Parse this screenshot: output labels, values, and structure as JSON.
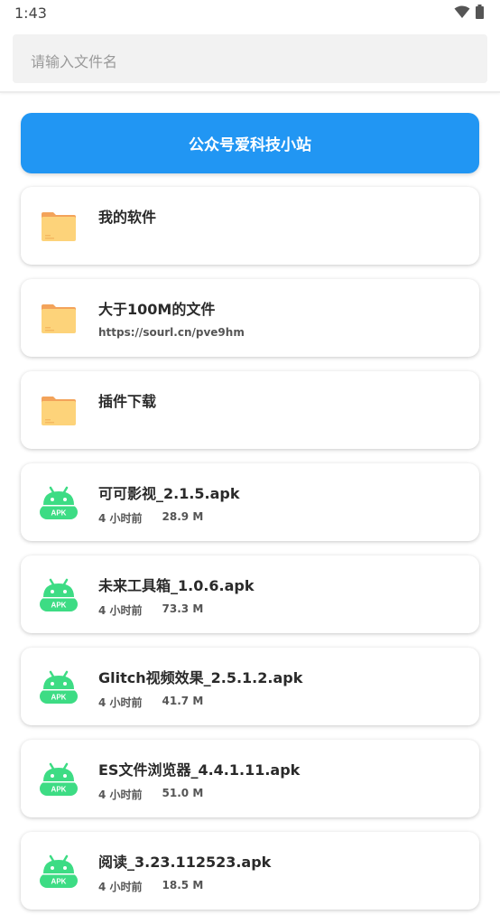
{
  "status_bar": {
    "time": "1:43"
  },
  "search": {
    "placeholder": "请输入文件名"
  },
  "banner": {
    "label": "公众号爱科技小站"
  },
  "folders": [
    {
      "name": "我的软件",
      "subtitle": ""
    },
    {
      "name": "大于100M的文件",
      "subtitle": "https://sourl.cn/pve9hm"
    },
    {
      "name": "插件下载",
      "subtitle": ""
    }
  ],
  "files": [
    {
      "name": "可可影视_2.1.5.apk",
      "time": "4 小时前",
      "size": "28.9 M"
    },
    {
      "name": "未来工具箱_1.0.6.apk",
      "time": "4 小时前",
      "size": "73.3 M"
    },
    {
      "name": "Glitch视频效果_2.5.1.2.apk",
      "time": "4 小时前",
      "size": "41.7 M"
    },
    {
      "name": "ES文件浏览器_4.4.1.11.apk",
      "time": "4 小时前",
      "size": "51.0 M"
    },
    {
      "name": "阅读_3.23.112523.apk",
      "time": "4 小时前",
      "size": "18.5 M"
    }
  ],
  "apk_badge": "APK",
  "colors": {
    "accent": "#2196f3",
    "folder": "#fdd37a",
    "folder_tab": "#f3a35a",
    "android": "#3ddc84"
  }
}
